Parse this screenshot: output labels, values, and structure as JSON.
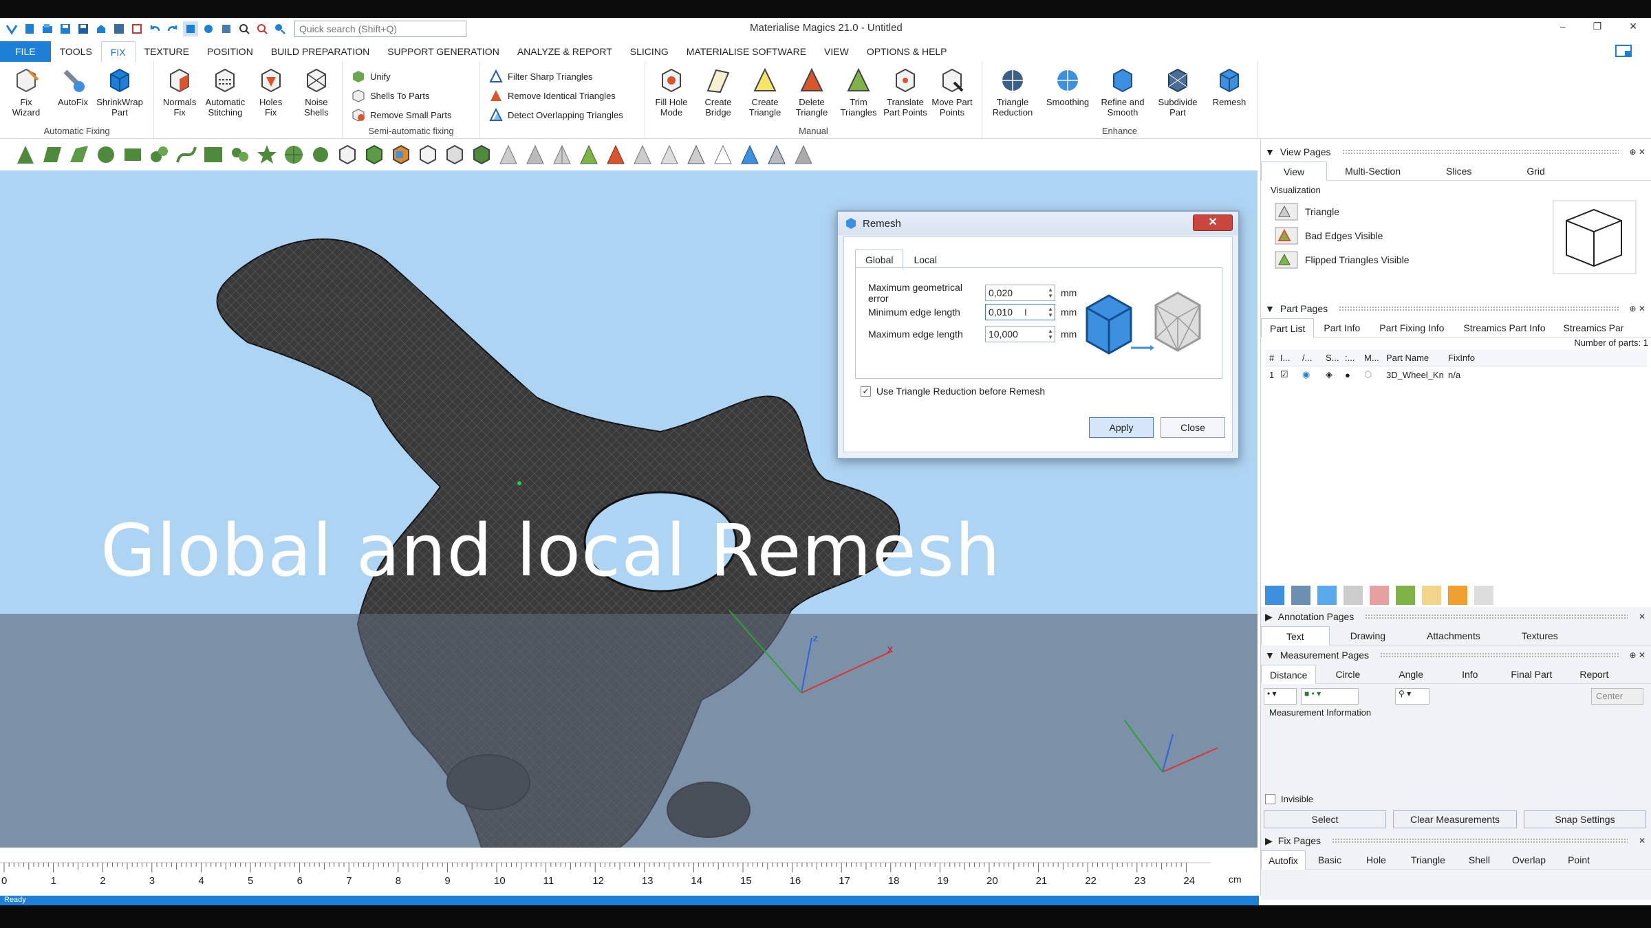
{
  "window": {
    "title": "Materialise Magics 21.0 - Untitled",
    "search_placeholder": "Quick search (Shift+Q)",
    "minimize": "–",
    "restore": "❐",
    "close": "✕"
  },
  "menu": {
    "tabs": [
      "FILE",
      "TOOLS",
      "FIX",
      "TEXTURE",
      "POSITION",
      "BUILD PREPARATION",
      "SUPPORT GENERATION",
      "ANALYZE & REPORT",
      "SLICING",
      "MATERIALISE SOFTWARE",
      "VIEW",
      "OPTIONS & HELP"
    ],
    "active": "FIX"
  },
  "ribbon": {
    "automatic": {
      "label": "Automatic Fixing",
      "buttons": [
        [
          "Fix",
          "Wizard"
        ],
        [
          "AutoFix",
          ""
        ],
        [
          "ShrinkWrap",
          "Part"
        ],
        [
          "Normals",
          "Fix"
        ],
        [
          "Automatic",
          "Stitching"
        ],
        [
          "Holes",
          "Fix"
        ],
        [
          "Noise",
          "Shells"
        ]
      ]
    },
    "semi": {
      "label": "Semi-automatic fixing",
      "items": [
        "Unify",
        "Shells To Parts",
        "Remove Small Parts"
      ]
    },
    "filter": {
      "items": [
        "Filter Sharp Triangles",
        "Remove Identical Triangles",
        "Detect Overlapping Triangles"
      ]
    },
    "manual": {
      "label": "Manual",
      "buttons": [
        [
          "Fill Hole",
          "Mode"
        ],
        [
          "Create",
          "Bridge"
        ],
        [
          "Create",
          "Triangle"
        ],
        [
          "Delete",
          "Triangle"
        ],
        [
          "Trim",
          "Triangles"
        ],
        [
          "Translate",
          "Part Points"
        ],
        [
          "Move Part",
          "Points"
        ]
      ]
    },
    "enhance": {
      "label": "Enhance",
      "buttons": [
        [
          "Triangle",
          "Reduction"
        ],
        [
          "Smoothing",
          ""
        ],
        [
          "Refine and",
          "Smooth"
        ],
        [
          "Subdivide",
          "Part"
        ],
        [
          "Remesh",
          ""
        ]
      ]
    }
  },
  "viewport": {
    "caption": "Global and local Remesh",
    "axis_x": "x",
    "axis_z": "z"
  },
  "ruler": {
    "ticks": [
      "0",
      "1",
      "2",
      "3",
      "4",
      "5",
      "6",
      "7",
      "8",
      "9",
      "10",
      "11",
      "12",
      "13",
      "14",
      "15",
      "16",
      "17",
      "18",
      "19",
      "20",
      "21",
      "22",
      "23",
      "24"
    ],
    "unit": "cm"
  },
  "status": {
    "text": "Ready"
  },
  "dialog": {
    "title": "Remesh",
    "close": "✕",
    "tabs": [
      "Global",
      "Local"
    ],
    "active_tab": "Global",
    "fields": [
      {
        "label": "Maximum geometrical error",
        "value": "0,020",
        "unit": "mm"
      },
      {
        "label": "Minimum edge length",
        "value": "0,010",
        "unit": "mm"
      },
      {
        "label": "Maximum edge length",
        "value": "10,000",
        "unit": "mm"
      }
    ],
    "checkbox_label": "Use Triangle Reduction before Remesh",
    "checkbox_checked": true,
    "apply": "Apply",
    "close_btn": "Close"
  },
  "view_pages": {
    "title": "View Pages",
    "tabs": [
      "View",
      "Multi-Section",
      "Slices",
      "Grid"
    ],
    "section": "Visualization",
    "items": [
      "Triangle",
      "Bad Edges Visible",
      "Flipped Triangles Visible"
    ]
  },
  "part_pages": {
    "title": "Part Pages",
    "tabs": [
      "Part List",
      "Part Info",
      "Part Fixing Info",
      "Streamics Part Info",
      "Streamics Par"
    ],
    "count_label": "Number of parts: 1",
    "columns": [
      "#",
      "I...",
      "/...",
      "S...",
      ":...",
      "M...",
      "Part Name",
      "FixInfo"
    ],
    "rows": [
      {
        "num": "1",
        "name": "3D_Wheel_Kn",
        "fixinfo": "n/a"
      }
    ]
  },
  "annotation_pages": {
    "title": "Annotation Pages",
    "tabs": [
      "Text",
      "Drawing",
      "Attachments",
      "Textures"
    ]
  },
  "measurement_pages": {
    "title": "Measurement Pages",
    "tabs": [
      "Distance",
      "Circle",
      "Angle",
      "Info",
      "Final Part",
      "Report"
    ],
    "center": "Center",
    "info_label": "Measurement Information",
    "invisible": "Invisible",
    "buttons": [
      "Select",
      "Clear Measurements",
      "Snap Settings"
    ]
  },
  "fix_pages": {
    "title": "Fix Pages",
    "tabs": [
      "Autofix",
      "Basic",
      "Hole",
      "Triangle",
      "Shell",
      "Overlap",
      "Point"
    ]
  },
  "colors": {
    "accent": "#1d7fd6",
    "viewport": "#aed4f3",
    "overlay": "#5c6878"
  }
}
